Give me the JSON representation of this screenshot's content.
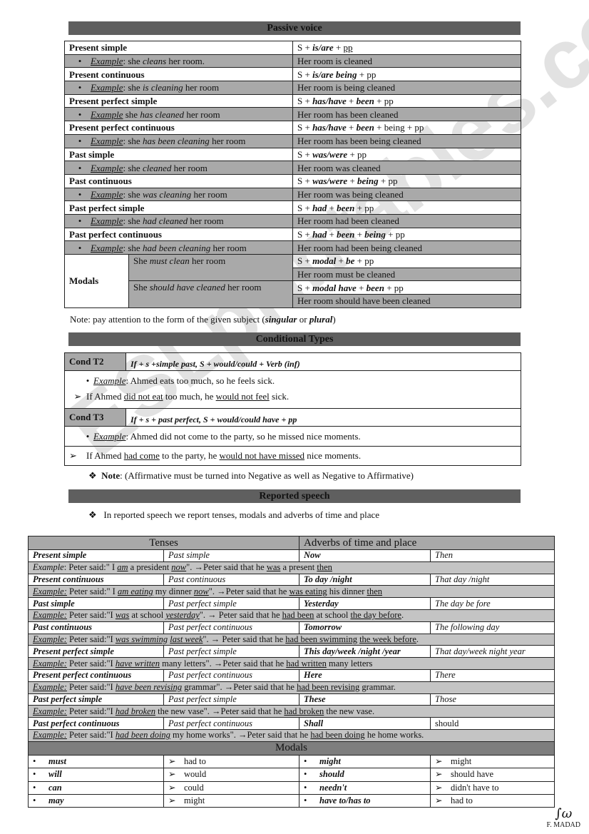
{
  "passive": {
    "title": "Passive voice",
    "rows": [
      {
        "tense": "Present simple",
        "formula": [
          {
            "t": "S + "
          },
          {
            "t": "is/are",
            "b": 1,
            "i": 1
          },
          {
            "t": " + "
          },
          {
            "t": "pp",
            "u": 1
          }
        ],
        "example": [
          {
            "t": "Example",
            "i": 1,
            "u": 1
          },
          {
            "t": ": she "
          },
          {
            "t": "cleans",
            "i": 1
          },
          {
            "t": " her room."
          }
        ],
        "passive": "Her room is cleaned"
      },
      {
        "tense": "Present continuous",
        "formula": [
          {
            "t": "S + "
          },
          {
            "t": "is/are being",
            "b": 1,
            "i": 1
          },
          {
            "t": " + pp"
          }
        ],
        "example": [
          {
            "t": "Example",
            "i": 1,
            "u": 1
          },
          {
            "t": ": she "
          },
          {
            "t": "is cleaning",
            "i": 1
          },
          {
            "t": " her room"
          }
        ],
        "passive": "Her room is being cleaned"
      },
      {
        "tense": "Present perfect simple",
        "formula": [
          {
            "t": "S + "
          },
          {
            "t": "has/have",
            "b": 1,
            "i": 1
          },
          {
            "t": " + "
          },
          {
            "t": "been",
            "b": 1,
            "i": 1
          },
          {
            "t": " + pp"
          }
        ],
        "example": [
          {
            "t": "Example",
            "i": 1,
            "u": 1
          },
          {
            "t": " she "
          },
          {
            "t": "has cleaned",
            "i": 1
          },
          {
            "t": " her room"
          }
        ],
        "passive": "Her room has been cleaned"
      },
      {
        "tense": "Present perfect continuous",
        "formula": [
          {
            "t": "S + "
          },
          {
            "t": "has/have",
            "b": 1,
            "i": 1
          },
          {
            "t": " + "
          },
          {
            "t": "been",
            "b": 1,
            "i": 1
          },
          {
            "t": " + being + pp"
          }
        ],
        "example": [
          {
            "t": "Example",
            "i": 1,
            "u": 1
          },
          {
            "t": ": she "
          },
          {
            "t": "has been cleaning",
            "i": 1
          },
          {
            "t": " her room"
          }
        ],
        "passive": "Her room has been being cleaned"
      },
      {
        "tense": "Past simple",
        "formula": [
          {
            "t": "S + "
          },
          {
            "t": "was/were",
            "b": 1,
            "i": 1
          },
          {
            "t": " + pp"
          }
        ],
        "example": [
          {
            "t": "Example",
            "i": 1,
            "u": 1
          },
          {
            "t": ": she "
          },
          {
            "t": "cleaned",
            "i": 1
          },
          {
            "t": " her room"
          }
        ],
        "passive": "Her room was cleaned"
      },
      {
        "tense": "Past continuous",
        "formula": [
          {
            "t": "S + "
          },
          {
            "t": "was/were",
            "b": 1,
            "i": 1
          },
          {
            "t": " + "
          },
          {
            "t": "being",
            "b": 1,
            "i": 1
          },
          {
            "t": " + pp"
          }
        ],
        "example": [
          {
            "t": "Example",
            "i": 1,
            "u": 1
          },
          {
            "t": ": she "
          },
          {
            "t": "was cleaning",
            "i": 1
          },
          {
            "t": " her room"
          }
        ],
        "passive": "Her room was being cleaned"
      },
      {
        "tense": "Past perfect simple",
        "formula": [
          {
            "t": "S + "
          },
          {
            "t": "had",
            "b": 1,
            "i": 1
          },
          {
            "t": " + "
          },
          {
            "t": "been",
            "b": 1,
            "i": 1
          },
          {
            "t": " + pp"
          }
        ],
        "example": [
          {
            "t": "Example",
            "i": 1,
            "u": 1
          },
          {
            "t": ": she "
          },
          {
            "t": "had cleaned",
            "i": 1
          },
          {
            "t": " her room"
          }
        ],
        "passive": "Her room had been cleaned"
      },
      {
        "tense": "Past perfect continuous",
        "formula": [
          {
            "t": "S + "
          },
          {
            "t": "had",
            "b": 1,
            "i": 1
          },
          {
            "t": " + "
          },
          {
            "t": "been",
            "b": 1,
            "i": 1
          },
          {
            "t": " + "
          },
          {
            "t": "being",
            "b": 1,
            "i": 1
          },
          {
            "t": " + pp"
          }
        ],
        "example": [
          {
            "t": "Example",
            "i": 1,
            "u": 1
          },
          {
            "t": ": she "
          },
          {
            "t": "had been cleaning",
            "i": 1
          },
          {
            "t": " her room"
          }
        ],
        "passive": "Her room had been being cleaned"
      }
    ],
    "modals": {
      "label": "Modals",
      "items": [
        {
          "example": [
            {
              "t": "She "
            },
            {
              "t": "must clean",
              "i": 1
            },
            {
              "t": " her room"
            }
          ],
          "formula": [
            {
              "t": "S + "
            },
            {
              "t": "modal",
              "b": 1,
              "i": 1
            },
            {
              "t": " + "
            },
            {
              "t": "be",
              "b": 1,
              "i": 1
            },
            {
              "t": " + pp"
            }
          ],
          "passive": "Her room must be cleaned"
        },
        {
          "example": [
            {
              "t": "She "
            },
            {
              "t": "should have cleaned",
              "i": 1
            },
            {
              "t": " her room"
            }
          ],
          "formula": [
            {
              "t": "S + "
            },
            {
              "t": "modal have",
              "b": 1,
              "i": 1
            },
            {
              "t": " + "
            },
            {
              "t": "been",
              "b": 1,
              "i": 1
            },
            {
              "t": " + pp"
            }
          ],
          "passive": "Her room should have been cleaned"
        }
      ]
    },
    "note": [
      {
        "t": "Note: pay attention to the form of the given subject ("
      },
      {
        "t": "singular",
        "b": 1,
        "i": 1
      },
      {
        "t": " or "
      },
      {
        "t": "plural",
        "b": 1,
        "i": 1
      },
      {
        "t": ")"
      }
    ]
  },
  "conditional": {
    "title": "Conditional Types",
    "types": [
      {
        "label": "Cond T2",
        "formula": "If + s +simple past, S  + would/could +  Verb (inf)",
        "example": [
          {
            "t": "Example",
            "i": 1,
            "u": 1
          },
          {
            "t": ": Ahmed eats too much, so he feels sick."
          }
        ],
        "conversion": [
          {
            "t": "If Ahmed "
          },
          {
            "t": "did not eat",
            "u": 1
          },
          {
            "t": " too much, he "
          },
          {
            "t": "would not feel",
            "u": 1
          },
          {
            "t": " sick."
          }
        ]
      },
      {
        "label": "Cond T3",
        "formula": "If + s + past perfect, S + would/could have + pp",
        "example": [
          {
            "t": "Example",
            "i": 1,
            "u": 1
          },
          {
            "t": ": Ahmed did not come to the party, so he missed nice moments."
          }
        ],
        "conversion": [
          {
            "t": "If Ahmed "
          },
          {
            "t": "had come",
            "u": 1
          },
          {
            "t": " to the party, he "
          },
          {
            "t": "would not have missed",
            "u": 1
          },
          {
            "t": " nice moments."
          }
        ]
      }
    ],
    "note": [
      {
        "t": "Note",
        "b": 1
      },
      {
        "t": ": (Affirmative must be turned into Negative as well as Negative to Affirmative)"
      }
    ]
  },
  "reported": {
    "title": "Reported speech",
    "intro": "In reported speech we report tenses, modals and  adverbs of time and place",
    "headers": {
      "tenses": "Tenses",
      "adverbs": "Adverbs of time and place"
    },
    "rows": [
      {
        "tense": "Present simple",
        "reported": "Past simple",
        "adverb": "Now",
        "reported_adverb": "Then",
        "example": [
          {
            "t": "Example",
            "i": 1
          },
          {
            "t": ": Peter said:\" I "
          },
          {
            "t": "am",
            "i": 1,
            "u": 1
          },
          {
            "t": " a president "
          },
          {
            "t": "now",
            "i": 1,
            "u": 1
          },
          {
            "t": "\". →Peter said that he "
          },
          {
            "t": "was",
            "u": 1
          },
          {
            "t": " a present "
          },
          {
            "t": "then",
            "u": 1
          }
        ]
      },
      {
        "tense": "Present continuous",
        "reported": "Past continuous",
        "adverb": "To day /night",
        "reported_adverb": "That day /night",
        "example": [
          {
            "t": "Example:",
            "i": 1,
            "u": 1
          },
          {
            "t": " Peter said:\" I "
          },
          {
            "t": "am eating",
            "i": 1,
            "u": 1
          },
          {
            "t": " my dinner "
          },
          {
            "t": "now",
            "i": 1,
            "u": 1
          },
          {
            "t": "\". →Peter said that he "
          },
          {
            "t": "was eating",
            "u": 1
          },
          {
            "t": " his dinner "
          },
          {
            "t": "then",
            "u": 1
          }
        ]
      },
      {
        "tense": "Past simple",
        "reported": "Past perfect simple",
        "adverb": "Yesterday",
        "reported_adverb": "The day be fore",
        "example": [
          {
            "t": "Example:",
            "i": 1,
            "u": 1
          },
          {
            "t": " Peter said:\"I "
          },
          {
            "t": "was",
            "i": 1,
            "u": 1
          },
          {
            "t": " at school "
          },
          {
            "t": "yesterday",
            "i": 1,
            "u": 1
          },
          {
            "t": "\". → Peter said that he "
          },
          {
            "t": "had been",
            "u": 1
          },
          {
            "t": " at school "
          },
          {
            "t": "the day before",
            "u": 1
          },
          {
            "t": "."
          }
        ]
      },
      {
        "tense": "Past continuous",
        "reported": "Past perfect continuous",
        "adverb": "Tomorrow",
        "reported_adverb": "The following day",
        "example": [
          {
            "t": "Example:",
            "i": 1,
            "u": 1
          },
          {
            "t": " Peter said:\"I "
          },
          {
            "t": "was swimming",
            "i": 1,
            "u": 1
          },
          {
            "t": " "
          },
          {
            "t": "last week",
            "i": 1,
            "u": 1
          },
          {
            "t": "\". → Peter said that he "
          },
          {
            "t": "had been swimming",
            "u": 1
          },
          {
            "t": " "
          },
          {
            "t": "the week before",
            "u": 1
          },
          {
            "t": "."
          }
        ]
      },
      {
        "tense": "Present perfect simple",
        "reported": "Past perfect simple",
        "adverb": "This day/week /night /year",
        "reported_adverb": "That day/week night year",
        "example": [
          {
            "t": "Example:",
            "i": 1,
            "u": 1
          },
          {
            "t": " Peter said:\"I "
          },
          {
            "t": "have written",
            "i": 1,
            "u": 1
          },
          {
            "t": " many letters\". →Peter said that he "
          },
          {
            "t": "had written",
            "u": 1
          },
          {
            "t": " many letters"
          }
        ]
      },
      {
        "tense": "Present perfect continuous",
        "reported": "Past perfect continuous",
        "adverb": "Here",
        "reported_adverb": "There",
        "example": [
          {
            "t": "Example:",
            "i": 1,
            "u": 1
          },
          {
            "t": " Peter said:\"I "
          },
          {
            "t": "have been revising",
            "i": 1,
            "u": 1
          },
          {
            "t": " grammar\". →Peter said that he "
          },
          {
            "t": "had been revising",
            "u": 1
          },
          {
            "t": " grammar."
          }
        ]
      },
      {
        "tense": "Past perfect simple",
        "reported": "Past perfect simple",
        "adverb": "These",
        "reported_adverb": "Those",
        "example": [
          {
            "t": "Example:",
            "i": 1,
            "u": 1
          },
          {
            "t": " Peter said:\"I "
          },
          {
            "t": "had broken",
            "i": 1,
            "u": 1
          },
          {
            "t": " the new vase\". →Peter said that he "
          },
          {
            "t": "had broken",
            "u": 1
          },
          {
            "t": " the new vase."
          }
        ]
      },
      {
        "tense": "Past perfect continuous",
        "reported": "Past perfect continuous",
        "adverb": "Shall",
        "reported_adverb": "should",
        "example": [
          {
            "t": "Example:",
            "i": 1,
            "u": 1
          },
          {
            "t": " Peter said:\"I "
          },
          {
            "t": "had been doing",
            "i": 1,
            "u": 1
          },
          {
            "t": " my home works\". →Peter said that he "
          },
          {
            "t": "had been doing",
            "u": 1
          },
          {
            "t": " he home works."
          }
        ]
      }
    ],
    "modals_title": "Modals",
    "modals": [
      {
        "a": "must",
        "a2": "had to",
        "b": "might",
        "b2": "might"
      },
      {
        "a": "will",
        "a2": "would",
        "b": "should",
        "b2": "should have"
      },
      {
        "a": "can",
        "a2": "could",
        "b": "needn't",
        "b2": "didn't have to"
      },
      {
        "a": "may",
        "a2": "might",
        "b": "have to/has to",
        "b2": "had to"
      }
    ]
  },
  "watermark": "ESLprintables.com",
  "signature": "F. MADAD"
}
